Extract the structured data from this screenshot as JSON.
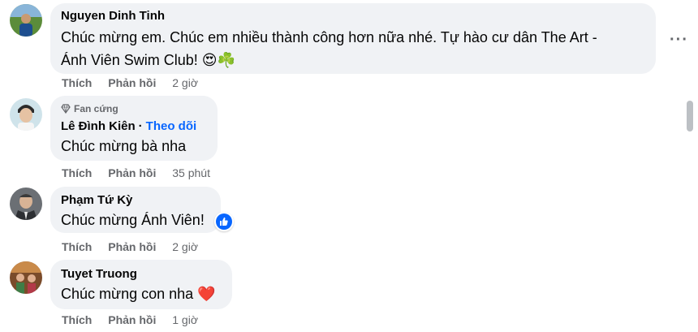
{
  "comments": [
    {
      "author": "Nguyen Dinh Tinh",
      "text_line1": "Chúc mừng em. Chúc em nhiều thành công hơn nữa nhé. Tự hào cư dân The Art -",
      "text_line2": "Ánh Viên Swim Club! 😍☘️",
      "like_label": "Thích",
      "reply_label": "Phản hồi",
      "time": "2 giờ"
    },
    {
      "badge": "Fan cứng",
      "author": "Lê Đình Kiên",
      "separator": "·",
      "follow_label": "Theo dõi",
      "text": "Chúc mừng bà nha",
      "like_label": "Thích",
      "reply_label": "Phản hồi",
      "time": "35 phút"
    },
    {
      "author": "Phạm Tứ Kỳ",
      "text": "Chúc mừng Ánh Viên!",
      "like_label": "Thích",
      "reply_label": "Phản hồi",
      "time": "2 giờ"
    },
    {
      "author": "Tuyet Truong",
      "text": "Chúc mừng con nha ❤️",
      "like_label": "Thích",
      "reply_label": "Phản hồi",
      "time": "1 giờ"
    }
  ],
  "more_options": "···",
  "icons": {
    "badge": "diamond-icon",
    "reaction": "like-icon",
    "more": "more-options-icon"
  },
  "colors": {
    "bubble": "#f0f2f5",
    "link": "#0866ff",
    "secondary": "#65676b"
  }
}
